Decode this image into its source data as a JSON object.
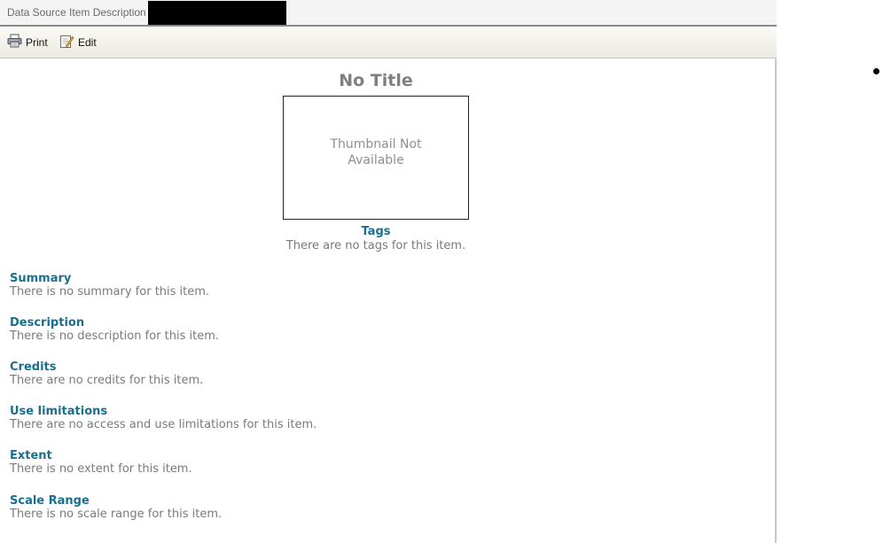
{
  "window": {
    "title": "Data Source Item Description"
  },
  "toolbar": {
    "print_label": "Print",
    "print_icon": "printer-icon",
    "edit_label": "Edit",
    "edit_icon": "edit-icon"
  },
  "item": {
    "title": "No Title",
    "thumbnail_text": "Thumbnail Not Available",
    "tags_heading": "Tags",
    "tags_text": "There are no tags for this item."
  },
  "sections": [
    {
      "heading": "Summary",
      "text": "There is no summary for this item."
    },
    {
      "heading": "Description",
      "text": "There is no description for this item."
    },
    {
      "heading": "Credits",
      "text": "There are no credits for this item."
    },
    {
      "heading": "Use limitations",
      "text": "There are no access and use limitations for this item."
    },
    {
      "heading": "Extent",
      "text": "There is no extent for this item."
    },
    {
      "heading": "Scale Range",
      "text": "There is no scale range for this item."
    }
  ],
  "colors": {
    "heading": "#1a6f8f",
    "body_text": "#7a7a7a",
    "title": "#7f7f7f"
  }
}
